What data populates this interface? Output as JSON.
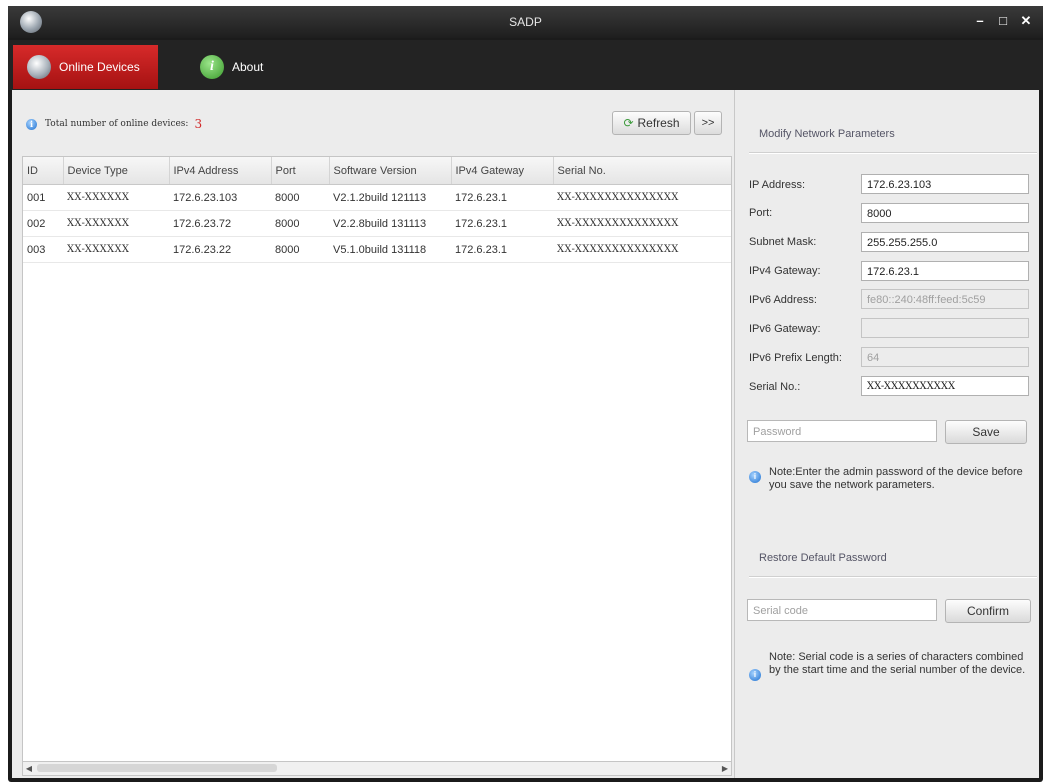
{
  "window": {
    "title": "SADP"
  },
  "tabs": [
    {
      "label": "Online Devices"
    },
    {
      "label": "About"
    }
  ],
  "device_list": {
    "total_label": "Total number of online devices:",
    "total_count": "3",
    "refresh_label": "Refresh",
    "expand_label": ">>",
    "columns": [
      "ID",
      "Device Type",
      "IPv4 Address",
      "Port",
      "Software Version",
      "IPv4 Gateway",
      "Serial No."
    ],
    "rows": [
      [
        "001",
        "XX-XXXXXX",
        "172.6.23.103",
        "8000",
        "V2.1.2build 121113",
        "172.6.23.1",
        "XX-XXXXXXXXXXXXXX"
      ],
      [
        "002",
        "XX-XXXXXX",
        "172.6.23.72",
        "8000",
        "V2.2.8build 131113",
        "172.6.23.1",
        "XX-XXXXXXXXXXXXXX"
      ],
      [
        "003",
        "XX-XXXXXX",
        "172.6.23.22",
        "8000",
        "V5.1.0build 131118",
        "172.6.23.1",
        "XX-XXXXXXXXXXXXXX"
      ]
    ]
  },
  "modify_panel": {
    "title": "Modify Network Parameters",
    "fields": [
      {
        "label": "IP Address:",
        "value": "172.6.23.103"
      },
      {
        "label": "Port:",
        "value": "8000"
      },
      {
        "label": "Subnet Mask:",
        "value": "255.255.255.0"
      },
      {
        "label": "IPv4 Gateway:",
        "value": "172.6.23.1"
      },
      {
        "label": "IPv6 Address:",
        "value": "fe80::240:48ff:feed:5c59"
      },
      {
        "label": "IPv6 Gateway:",
        "value": ""
      },
      {
        "label": "IPv6 Prefix Length:",
        "value": "64"
      },
      {
        "label": "Serial No.:",
        "value": "XX-XXXXXXXXXX"
      }
    ],
    "password_placeholder": "Password",
    "save_label": "Save",
    "note": "Note:Enter the admin password of the device before you save the network parameters."
  },
  "restore_panel": {
    "title": "Restore Default Password",
    "serial_placeholder": "Serial code",
    "confirm_label": "Confirm",
    "note": "Note: Serial code is a series of characters combined by the start time and the serial number of the device."
  },
  "icons": {
    "app": "sadp-logo-icon",
    "info": "info-icon",
    "refresh": "refresh-icon"
  }
}
